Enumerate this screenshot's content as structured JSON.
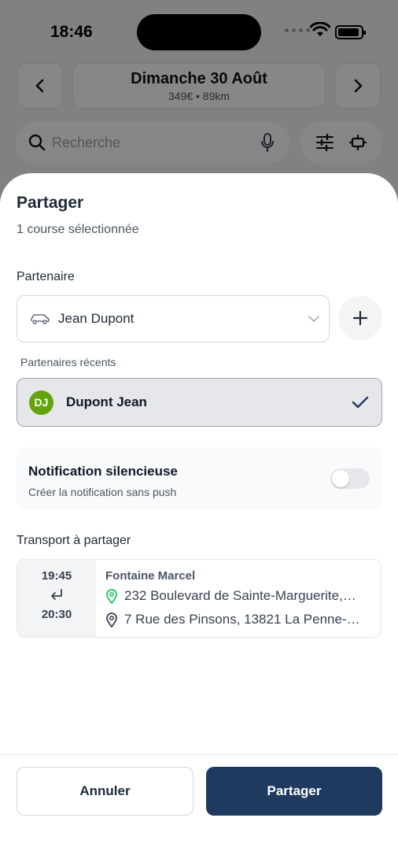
{
  "status_bar": {
    "time": "18:46"
  },
  "header": {
    "date_title": "Dimanche 30 Août",
    "date_subtitle": "349€ • 89km"
  },
  "search": {
    "placeholder": "Recherche"
  },
  "sheet": {
    "title": "Partager",
    "subtitle": "1 course sélectionnée",
    "partner_label": "Partenaire",
    "partner_selected": "Jean Dupont",
    "recent_label": "Partenaires récents",
    "recent_partners": [
      {
        "initials": "DJ",
        "name": "Dupont Jean",
        "selected": true,
        "avatar_color": "#65a30d"
      }
    ],
    "silent_notification": {
      "title": "Notification silencieuse",
      "description": "Créer la notification sans push",
      "enabled": false
    },
    "transport_label": "Transport à partager",
    "transport": {
      "start_time": "19:45",
      "end_time": "20:30",
      "passenger": "Fontaine Marcel",
      "pickup": "232 Boulevard de Sainte-Marguerite,…",
      "dropoff": "7 Rue des Pinsons, 13821 La Penne-…"
    },
    "cancel_label": "Annuler",
    "share_label": "Partager"
  },
  "colors": {
    "primary": "#1e3a5f",
    "avatar": "#65a30d",
    "pickup_pin": "#22c55e",
    "dropoff_pin": "#374151"
  }
}
